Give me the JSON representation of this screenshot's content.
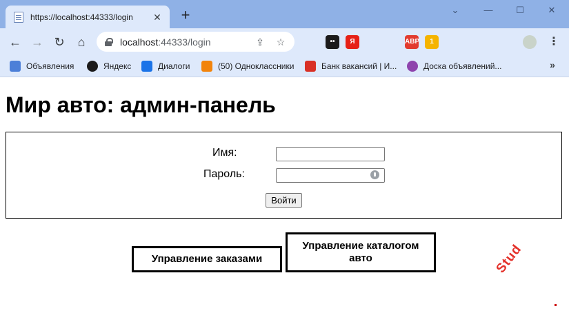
{
  "browser": {
    "tab": {
      "title": "https://localhost:44333/login",
      "close": "✕"
    },
    "new_tab": "+",
    "window_controls": {
      "minimize": "—",
      "maximize": "☐",
      "close": "✕",
      "tabsearch": "⌄"
    },
    "nav": {
      "back": "←",
      "forward": "→",
      "reload": "↻",
      "home": "⌂"
    },
    "address": {
      "host": "localhost",
      "rest": ":44333/login"
    },
    "omnibox_icons": {
      "share": "⇪",
      "star": "☆"
    },
    "extensions": [
      {
        "icon": "tapermonkey-icon",
        "label": "••",
        "color": "#1b1b1b"
      },
      {
        "icon": "yandex-icon",
        "label": "Я",
        "color": "#e62117"
      },
      {
        "icon": "key-icon",
        "label": "",
        "color": "#3c4043"
      },
      {
        "icon": "house-icon",
        "label": "",
        "color": "#3ba55c"
      },
      {
        "icon": "adblock-icon",
        "label": "ABP",
        "color": "#e23b2e"
      },
      {
        "icon": "notification-icon",
        "label": "1",
        "color": "#f5b400"
      },
      {
        "icon": "globe-icon",
        "label": "",
        "color": "#1a73e8"
      },
      {
        "icon": "puzzle-icon",
        "label": "",
        "color": "#3c4043"
      },
      {
        "icon": "media-icon",
        "label": "",
        "color": "#3c4043"
      },
      {
        "icon": "sidepanel-icon",
        "label": "",
        "color": "#3c4043"
      },
      {
        "icon": "avatar-icon",
        "label": "",
        "color": "#7b8b7b"
      },
      {
        "icon": "menu-icon",
        "label": "⋮",
        "color": "#3c4043"
      }
    ],
    "bookmarks": [
      {
        "label": "Объявления",
        "icon": "doc-icon",
        "color": "#4c7fd8"
      },
      {
        "label": "Яндекс",
        "icon": "yandex-compass-icon",
        "color": "#1b1b1b"
      },
      {
        "label": "Диалоги",
        "icon": "chat-icon",
        "color": "#1a73e8"
      },
      {
        "label": "(50) Одноклассники",
        "icon": "ok-icon",
        "color": "#f2840c"
      },
      {
        "label": "Банк вакансий | И...",
        "icon": "jobs-icon",
        "color": "#d93025"
      },
      {
        "label": "Доска объявлений...",
        "icon": "board-icon",
        "color": "#8e44ad"
      }
    ],
    "bookmarks_more": "»"
  },
  "page": {
    "title": "Мир авто: админ-панель",
    "login": {
      "name_label": "Имя:",
      "name_value": "",
      "password_label": "Пароль:",
      "password_value": "",
      "submit_label": "Войти"
    },
    "buttons": {
      "orders": "Управление заказами",
      "catalog": "Управление каталогом авто"
    },
    "watermark": "Stud"
  }
}
